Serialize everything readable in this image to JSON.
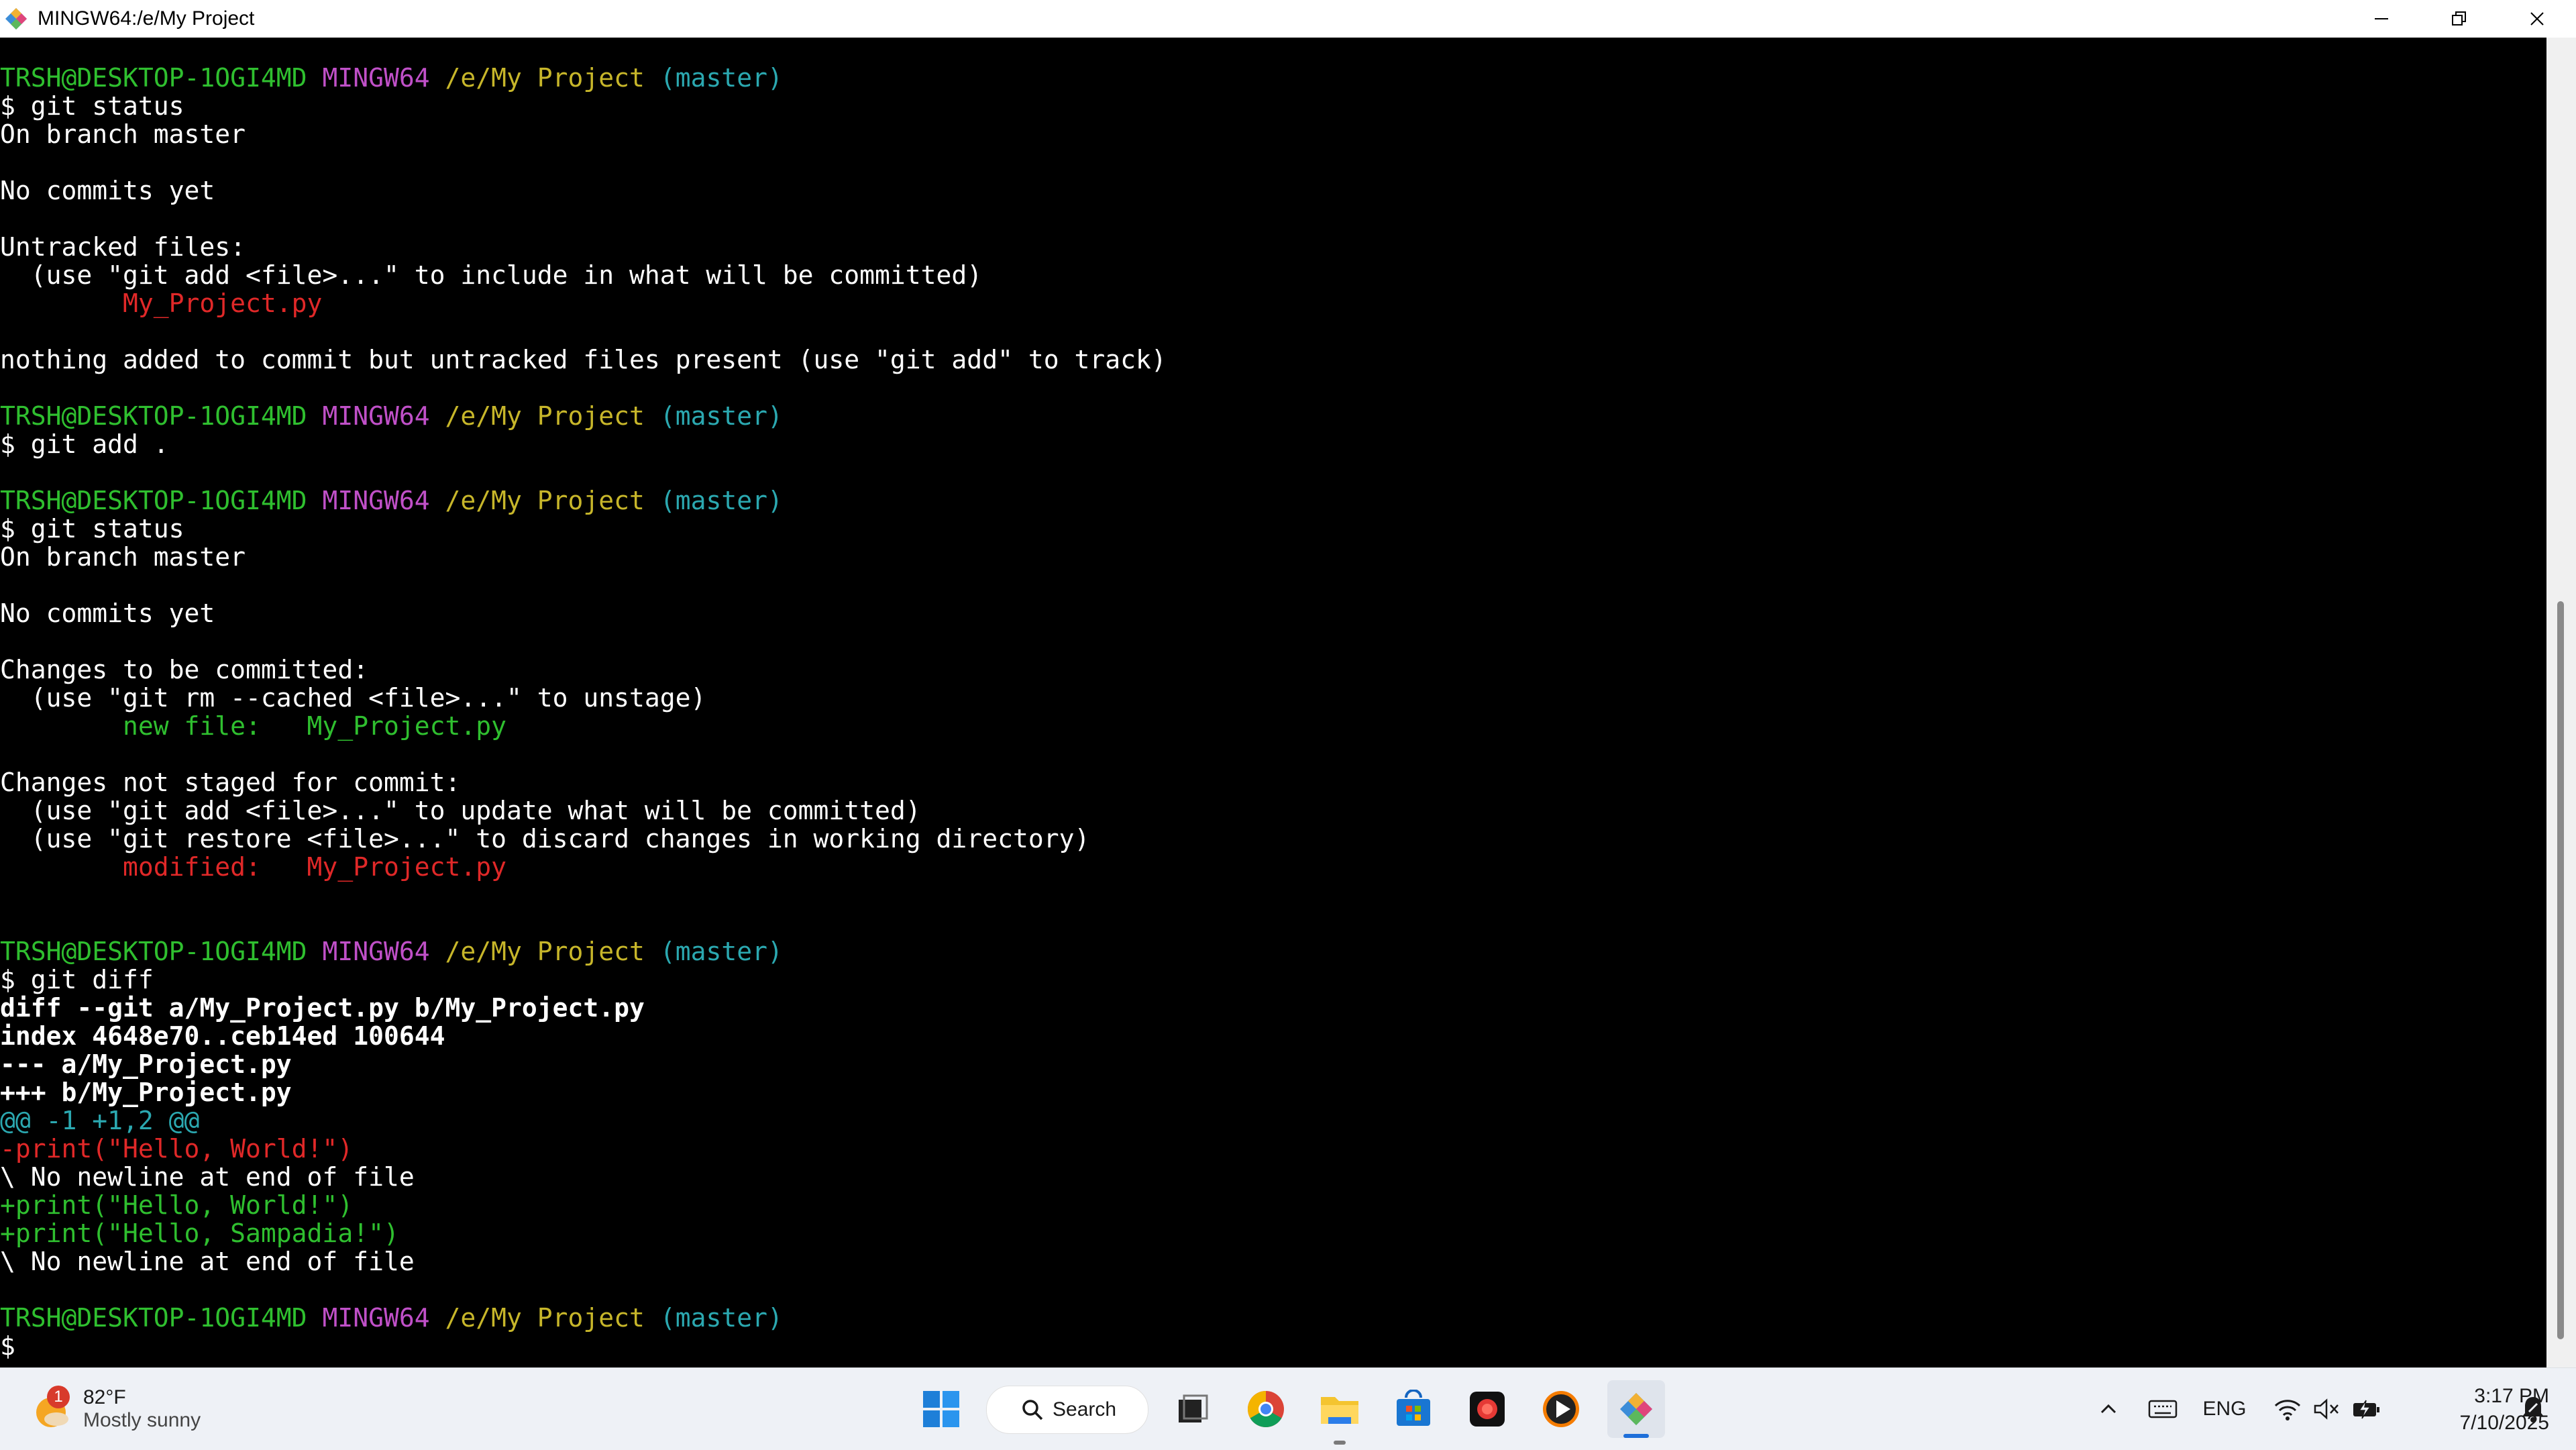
{
  "window": {
    "title": "MINGW64:/e/My Project"
  },
  "prompt": {
    "user_host": "TRSH@DESKTOP-1OGI4MD",
    "env": "MINGW64",
    "path": "/e/My Project",
    "branch": "(master)"
  },
  "terminal": {
    "cmd_status_1": "$ git status",
    "on_branch_1": "On branch master",
    "no_commits_1": "No commits yet",
    "untracked_header": "Untracked files:",
    "untracked_hint": "  (use \"git add <file>...\" to include in what will be committed)",
    "untracked_file": "        My_Project.py",
    "nothing_added": "nothing added to commit but untracked files present (use \"git add\" to track)",
    "cmd_add": "$ git add .",
    "cmd_status_2": "$ git status",
    "on_branch_2": "On branch master",
    "no_commits_2": "No commits yet",
    "changes_header": "Changes to be committed:",
    "changes_hint": "  (use \"git rm --cached <file>...\" to unstage)",
    "new_file": "        new file:   My_Project.py",
    "not_staged_header": "Changes not staged for commit:",
    "not_staged_hint_1": "  (use \"git add <file>...\" to update what will be committed)",
    "not_staged_hint_2": "  (use \"git restore <file>...\" to discard changes in working directory)",
    "modified_file": "        modified:   My_Project.py",
    "cmd_diff": "$ git diff",
    "diff_header": "diff --git a/My_Project.py b/My_Project.py",
    "diff_index": "index 4648e70..ceb14ed 100644",
    "diff_minus_file": "--- a/My_Project.py",
    "diff_plus_file": "+++ b/My_Project.py",
    "diff_hunk": "@@ -1 +1,2 @@",
    "diff_removed": "-print(\"Hello, World!\")",
    "no_newline_1": "\\ No newline at end of file",
    "diff_added_1": "+print(\"Hello, World!\")",
    "diff_added_2": "+print(\"Hello, Sampadia!\")",
    "no_newline_2": "\\ No newline at end of file",
    "cursor_prompt": "$"
  },
  "taskbar": {
    "weather": {
      "badge": "1",
      "temp": "82°F",
      "condition": "Mostly sunny"
    },
    "search_label": "Search",
    "tray": {
      "language": "ENG"
    },
    "clock": {
      "time": "3:17 PM",
      "date": "7/10/2025"
    }
  },
  "colors": {
    "prompt_user": "#2fbf2f",
    "prompt_env": "#c050c8",
    "prompt_path": "#c7b62a",
    "prompt_branch": "#2ba8b0",
    "untracked_red": "#e02828",
    "staged_green": "#2fbf2f"
  }
}
